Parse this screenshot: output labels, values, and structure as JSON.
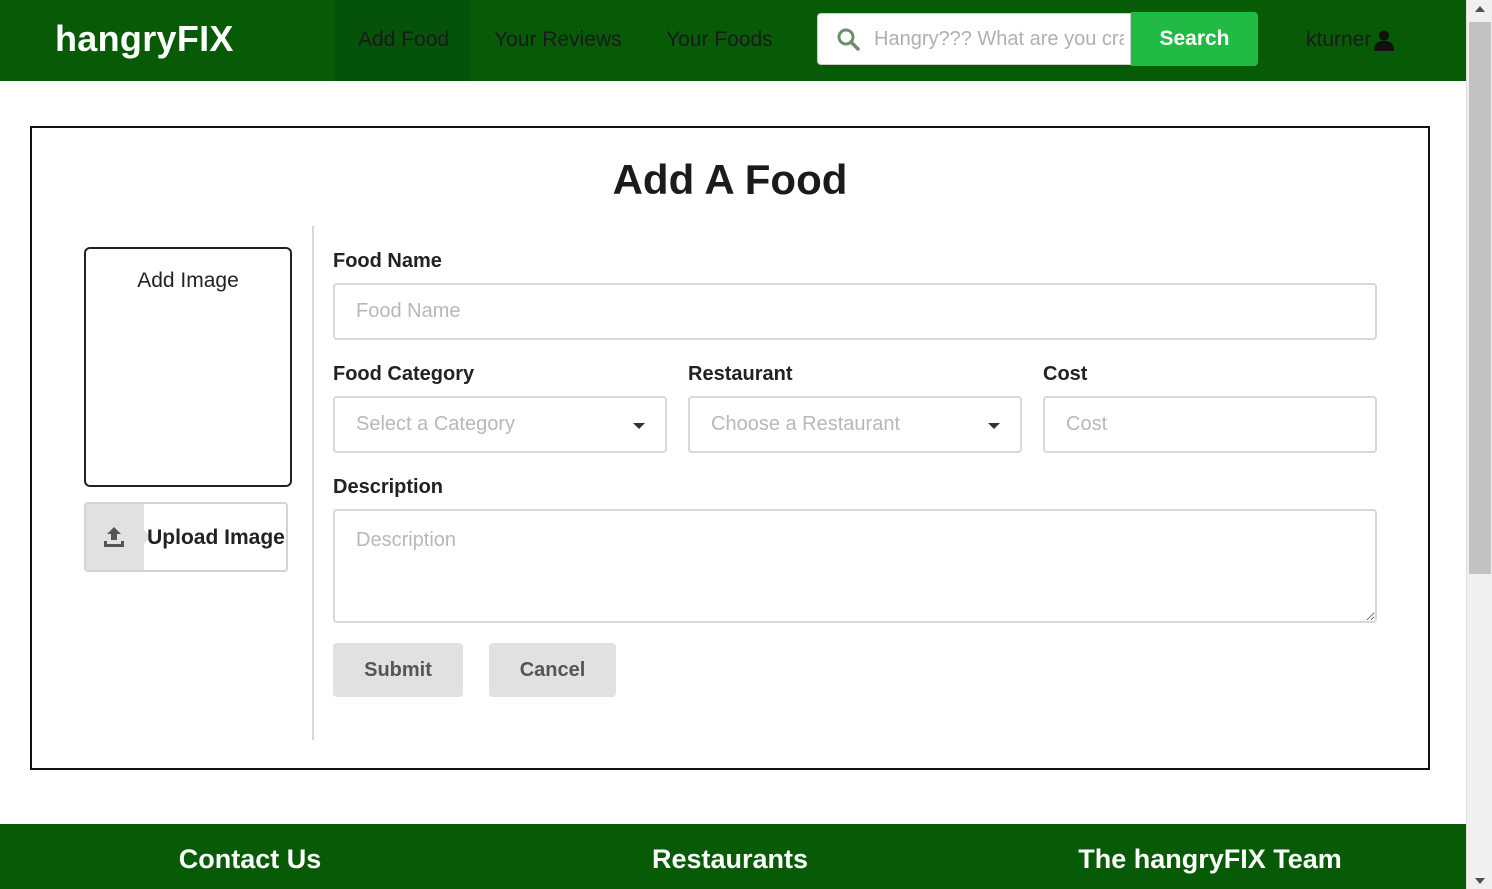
{
  "navbar": {
    "brand": "hangryFIX",
    "links": [
      "Add Food",
      "Your Reviews",
      "Your Foods"
    ],
    "search": {
      "placeholder": "Hangry??? What are you craving?",
      "button_label": "Search",
      "icon": "search-icon"
    },
    "user": {
      "name": "kturner",
      "icon": "user-icon"
    },
    "colors": {
      "background": "#075b06",
      "search_button": "#21ba45"
    }
  },
  "form": {
    "title": "Add A Food",
    "image_box_label": "Add Image",
    "upload_button_label": "Upload Image",
    "upload_icon": "upload-icon",
    "fields": {
      "food_name": {
        "label": "Food Name",
        "placeholder": "Food Name",
        "value": ""
      },
      "food_category": {
        "label": "Food Category",
        "placeholder": "Select a Category"
      },
      "restaurant": {
        "label": "Restaurant",
        "placeholder": "Choose a Restaurant"
      },
      "cost": {
        "label": "Cost",
        "placeholder": "Cost",
        "value": ""
      },
      "description": {
        "label": "Description",
        "placeholder": "Description",
        "value": ""
      }
    },
    "buttons": {
      "submit": "Submit",
      "cancel": "Cancel"
    }
  },
  "footer": {
    "headings": [
      "Contact Us",
      "Restaurants",
      "The hangryFIX Team"
    ]
  }
}
